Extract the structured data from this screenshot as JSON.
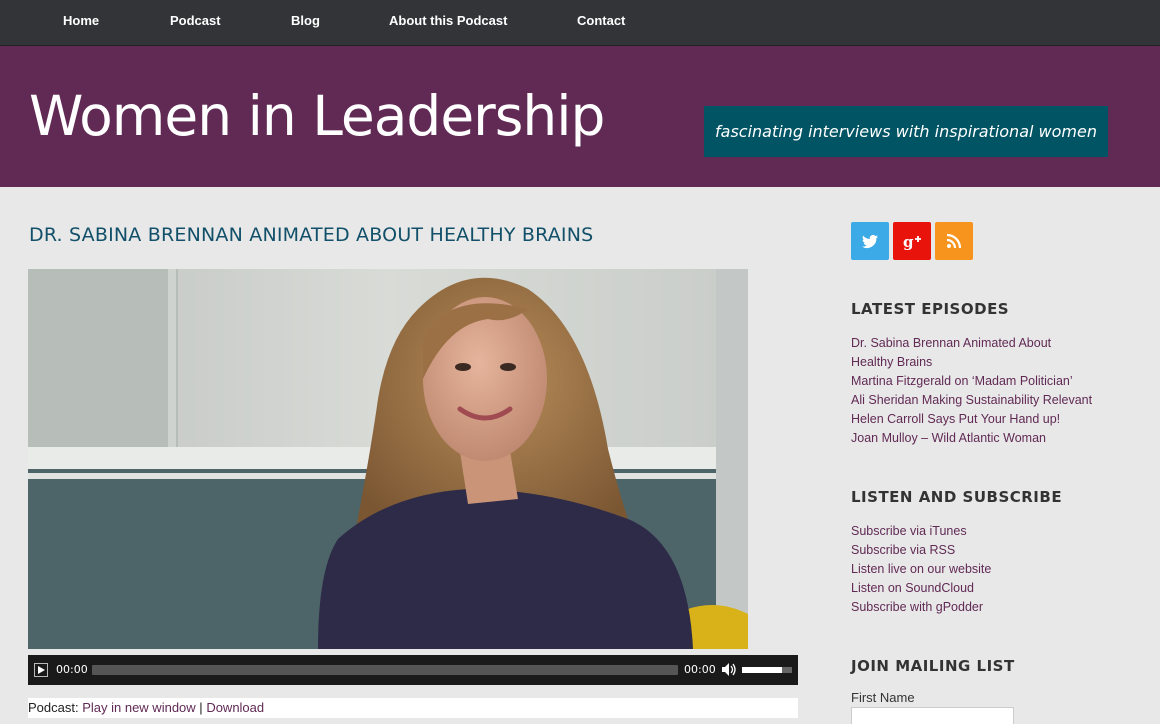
{
  "nav": {
    "items": [
      {
        "label": "Home"
      },
      {
        "label": "Podcast"
      },
      {
        "label": "Blog"
      },
      {
        "label": "About this Podcast"
      },
      {
        "label": "Contact"
      }
    ]
  },
  "header": {
    "site_title": "Women in Leadership",
    "tagline": "fascinating interviews with inspirational women"
  },
  "post": {
    "title": "DR. SABINA BRENNAN ANIMATED ABOUT HEALTHY BRAINS"
  },
  "player": {
    "current_time": "00:00",
    "duration": "00:00",
    "progress_fraction": 0,
    "volume_fraction": 0.8
  },
  "podcast_links": {
    "prefix": "Podcast:",
    "play_new_window": "Play in new window",
    "separator": "|",
    "download": "Download"
  },
  "sidebar": {
    "social": [
      {
        "icon": "twitter-icon",
        "color": "#3daae8"
      },
      {
        "icon": "google-plus-icon",
        "color": "#e8140c"
      },
      {
        "icon": "rss-icon",
        "color": "#f7941d"
      }
    ],
    "latest_episodes": {
      "heading": "LATEST EPISODES",
      "items": [
        {
          "line1": "Dr. Sabina Brennan Animated About",
          "line2": "Healthy Brains"
        },
        {
          "line1": "Martina Fitzgerald on ‘Madam Politician’",
          "line2": ""
        },
        {
          "line1": "Ali Sheridan Making Sustainability Relevant",
          "line2": ""
        },
        {
          "line1": "Helen Carroll Says Put Your Hand up!",
          "line2": ""
        },
        {
          "line1": "Joan Mulloy – Wild Atlantic Woman",
          "line2": ""
        }
      ]
    },
    "listen_subscribe": {
      "heading": "LISTEN AND SUBSCRIBE",
      "items": [
        {
          "label": "Subscribe via iTunes"
        },
        {
          "label": "Subscribe via RSS"
        },
        {
          "label": "Listen live on our website"
        },
        {
          "label": "Listen on SoundCloud"
        },
        {
          "label": "Subscribe with gPodder"
        }
      ]
    },
    "mailing_list": {
      "heading": "JOIN MAILING LIST",
      "first_name_label": "First Name"
    }
  }
}
